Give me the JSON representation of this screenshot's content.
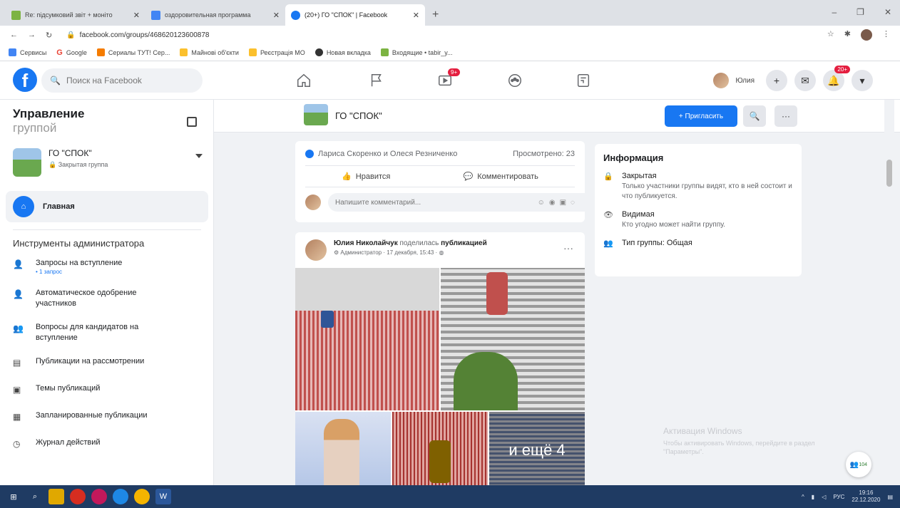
{
  "browser": {
    "tabs": [
      {
        "title": "Re: підсумковий звіт + моніто",
        "color": "#7cb342",
        "active": false
      },
      {
        "title": "оздоровительная программа",
        "color": "#4285f4",
        "active": false
      },
      {
        "title": "(20+) ГО \"СПОК\" | Facebook",
        "color": "#1877f2",
        "active": true
      }
    ],
    "new_tab": "+",
    "url": "facebook.com/groups/468620123600878",
    "bookmarks": [
      {
        "label": "Сервисы",
        "color": "#4285f4"
      },
      {
        "label": "Google",
        "color": "#ea4335"
      },
      {
        "label": "Сериалы ТУТ! Сер...",
        "color": "#f57c00"
      },
      {
        "label": "Майнові об'єкти",
        "color": "#fbc02d"
      },
      {
        "label": "Реєстрація МО",
        "color": "#fbc02d"
      },
      {
        "label": "Новая вкладка",
        "color": "#333333"
      },
      {
        "label": "Входящие • tabir_y...",
        "color": "#7cb342"
      }
    ]
  },
  "header": {
    "logo": "f",
    "search_placeholder": "Поиск на Facebook",
    "video_badge": "9+",
    "user_name": "Юлия",
    "notif_badge": "20+"
  },
  "sidebar": {
    "title": "Управление",
    "title_sub": "группой",
    "group_name": "ГО \"СПОК\"",
    "group_type": "Закрытая группа",
    "home_label": "Главная",
    "tools_heading": "Инструменты администратора",
    "tools": [
      {
        "label": "Запросы на вступление",
        "meta": "• 1 запрос"
      },
      {
        "label": "Автоматическое одобрение участников",
        "meta": ""
      },
      {
        "label": "Вопросы для кандидатов на вступление",
        "meta": ""
      },
      {
        "label": "Публикации на рассмотрении",
        "meta": ""
      },
      {
        "label": "Темы публикаций",
        "meta": ""
      },
      {
        "label": "Запланированные публикации",
        "meta": ""
      },
      {
        "label": "Журнал действий",
        "meta": ""
      }
    ]
  },
  "group_bar": {
    "name": "ГО \"СПОК\"",
    "invite": "+ Пригласить",
    "search": "🔍",
    "more": "···"
  },
  "post1": {
    "reactors": "Лариса Скоренко и Олеся Резниченко",
    "seen": "Просмотрено: 23",
    "like": "Нравится",
    "comment": "Комментировать",
    "comment_placeholder": "Напишите комментарий..."
  },
  "post2": {
    "author": "Юлия Николайчук",
    "action": "поделилась",
    "object": "публикацией",
    "meta": "Администратор · 17 декабря, 15:43 ·",
    "more_photos": "и ещё 4"
  },
  "info": {
    "heading": "Информация",
    "rows": [
      {
        "icon": "🔒",
        "title": "Закрытая",
        "desc": "Только участники группы видят, кто в ней состоит и что публикуется."
      },
      {
        "icon": "👁",
        "title": "Видимая",
        "desc": "Кто угодно может найти группу."
      },
      {
        "icon": "👥",
        "title": "Тип группы: Общая",
        "desc": ""
      }
    ]
  },
  "activation": {
    "title": "Активация Windows",
    "desc": "Чтобы активировать Windows, перейдите в раздел \"Параметры\"."
  },
  "chat_fab": {
    "badge": "104"
  },
  "taskbar": {
    "lang": "РУС",
    "time": "19:16",
    "date": "22.12.2020"
  }
}
